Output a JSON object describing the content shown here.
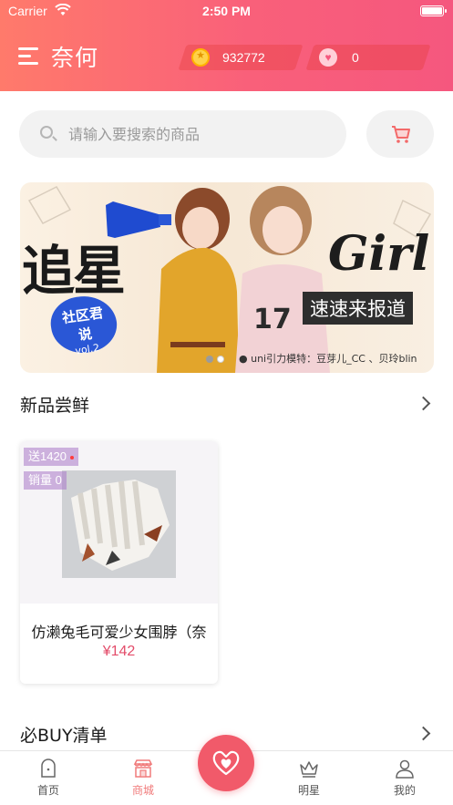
{
  "status_bar": {
    "carrier": "Carrier",
    "time": "2:50 PM"
  },
  "header": {
    "brand": "奈何",
    "coins": "932772",
    "hearts": "0"
  },
  "search": {
    "placeholder": "请输入要搜索的商品"
  },
  "banner": {
    "headline": "追星",
    "girl_text": "Girl",
    "subtitle": "速速来报道",
    "badge_line1": "社区君",
    "badge_line2": "说",
    "badge_vol": "vol.2",
    "caption": "uni引力模特：豆芽儿_CC 、贝玲blin"
  },
  "sections": {
    "new_products": "新品尝鲜",
    "must_buy": "必BUY清单"
  },
  "product": {
    "gift_tag": "送1420",
    "sales_tag": "销量 0",
    "name": "仿濑兔毛可爱少女围脖（奈",
    "price": "¥142"
  },
  "tabbar": {
    "items": [
      {
        "label": "首页",
        "icon": "home-icon",
        "active": false
      },
      {
        "label": "商城",
        "icon": "store-icon",
        "active": true
      },
      {
        "label": "明星",
        "icon": "crown-icon",
        "active": false
      },
      {
        "label": "我的",
        "icon": "user-icon",
        "active": false
      }
    ]
  },
  "colors": {
    "accent": "#f5577e",
    "header_start": "#ff7a6b",
    "price": "#e34c6a",
    "tab_active": "#f07a7a"
  }
}
